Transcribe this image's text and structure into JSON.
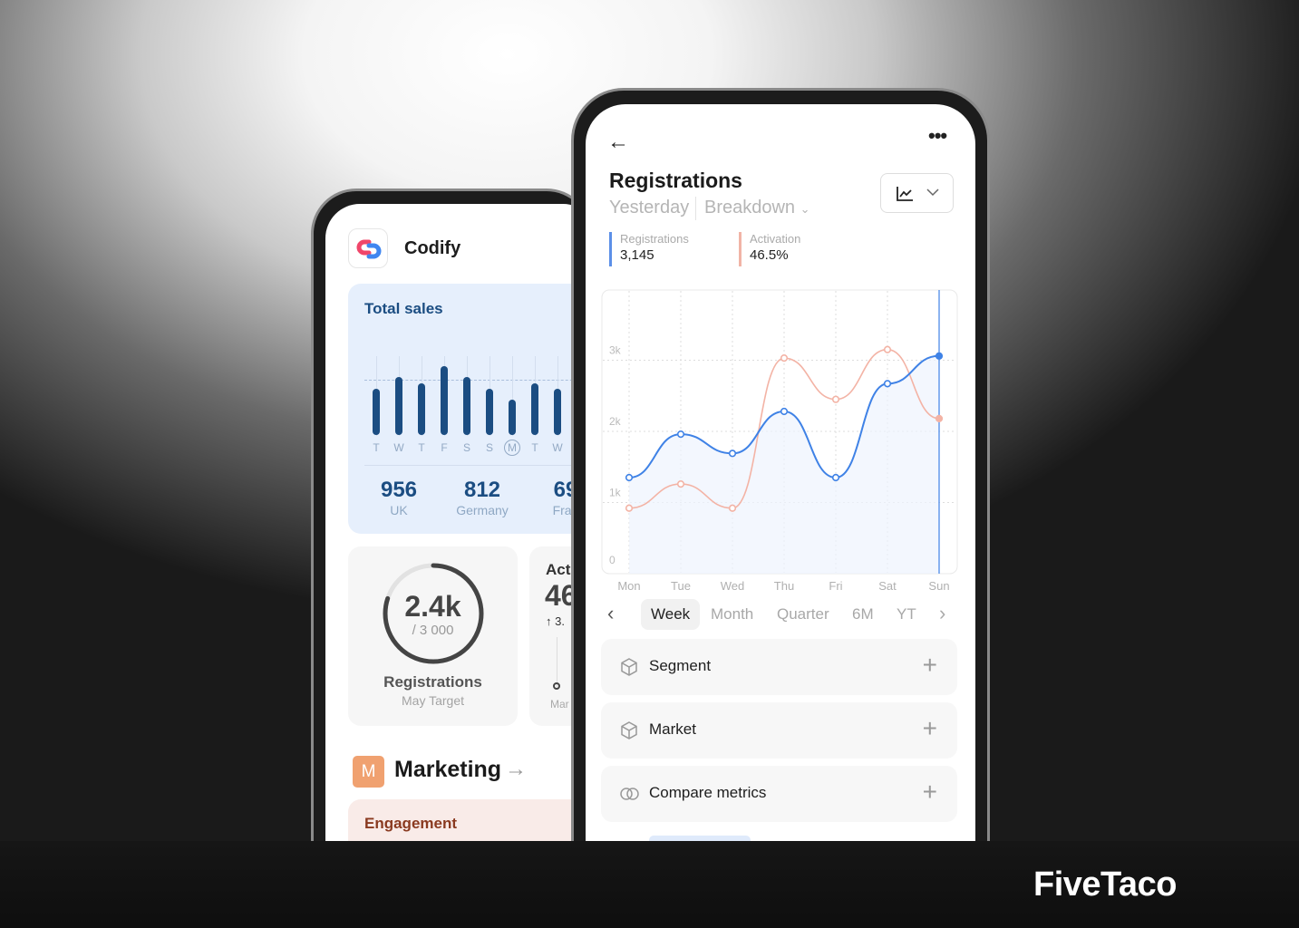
{
  "brand": {
    "name": "FiveTaco"
  },
  "left_phone": {
    "app_name": "Codify",
    "total_sales": {
      "title": "Total sales",
      "days": [
        "T",
        "W",
        "T",
        "F",
        "S",
        "S",
        "M",
        "T",
        "W"
      ],
      "selected_day": "M",
      "bar_values": [
        0.62,
        0.78,
        0.7,
        0.93,
        0.78,
        0.62,
        0.48,
        0.7,
        0.62
      ],
      "stats": [
        {
          "value": "956",
          "label": "UK"
        },
        {
          "value": "812",
          "label": "Germany"
        },
        {
          "value": "69",
          "label": "Fran"
        }
      ]
    },
    "registrations_card": {
      "value": "2.4k",
      "target": "/ 3 000",
      "title": "Registrations",
      "subtitle": "May Target",
      "progress": 0.8
    },
    "activation_card": {
      "title": "Act",
      "value": "46",
      "delta": "↑ 3.",
      "axis_label": "Mar"
    },
    "section": {
      "badge": "M",
      "title": "Marketing"
    },
    "engagement": {
      "title": "Engagement"
    }
  },
  "right_phone": {
    "title": "Registrations",
    "period": "Yesterday",
    "breakdown": "Breakdown",
    "metrics": [
      {
        "label": "Registrations",
        "value": "3,145",
        "color": "#5b8fe8"
      },
      {
        "label": "Activation",
        "value": "46.5%",
        "color": "#f1b4a6"
      }
    ],
    "ranges": [
      "Week",
      "Month",
      "Quarter",
      "6M",
      "YT"
    ],
    "selected_range": "Week",
    "rows": [
      {
        "label": "Segment",
        "icon": "cube-icon"
      },
      {
        "label": "Market",
        "icon": "cube-icon"
      },
      {
        "label": "Compare metrics",
        "icon": "overlap-circles-icon"
      }
    ]
  },
  "chart_data": {
    "type": "line",
    "x": [
      "Mon",
      "Tue",
      "Wed",
      "Thu",
      "Fri",
      "Sat",
      "Sun"
    ],
    "yticks": [
      "0",
      "1k",
      "2k",
      "3k"
    ],
    "ylim": [
      0,
      4000
    ],
    "grid": true,
    "series": [
      {
        "name": "Registrations",
        "color": "#3f82e6",
        "values": [
          1350,
          1960,
          1690,
          2280,
          1350,
          2670,
          3060
        ]
      },
      {
        "name": "Activation",
        "color": "#f3b3a5",
        "values": [
          920,
          1260,
          920,
          3030,
          2450,
          3150,
          2180
        ]
      }
    ],
    "highlight": "Sun"
  }
}
